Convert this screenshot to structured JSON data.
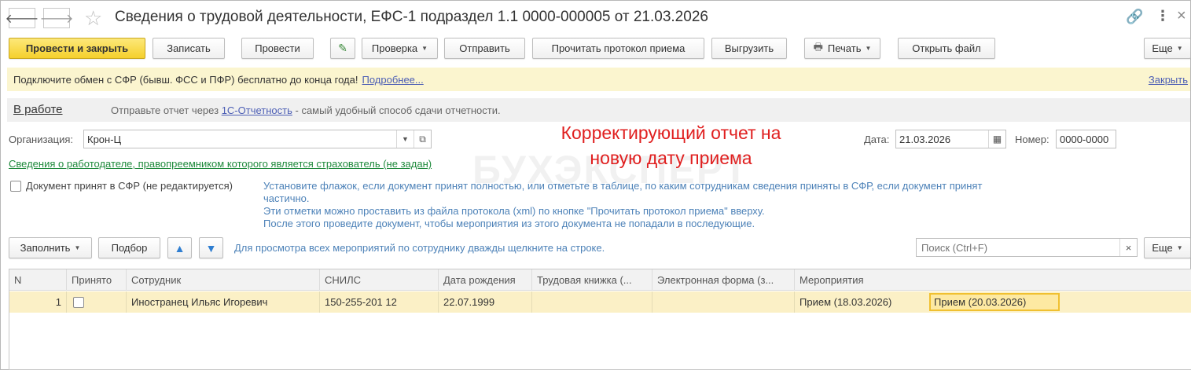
{
  "window": {
    "title": "Сведения о трудовой деятельности, ЕФС-1 подраздел 1.1 0000-000005 от 21.03.2026"
  },
  "toolbar": {
    "post_close": "Провести и закрыть",
    "save": "Записать",
    "post": "Провести",
    "check": "Проверка",
    "send": "Отправить",
    "read_protocol": "Прочитать протокол приема",
    "export": "Выгрузить",
    "print": "Печать",
    "open_file": "Открыть файл",
    "more": "Еще"
  },
  "infobar": {
    "text": "Подключите обмен с СФР (бывш. ФСС и ПФР) бесплатно до конца года!",
    "link": "Подробнее...",
    "close": "Закрыть"
  },
  "status": {
    "label": "В работе",
    "text_before": "Отправьте отчет через",
    "link": "1С-Отчетность",
    "text_after": "- самый удобный способ сдачи отчетности."
  },
  "form": {
    "org_label": "Организация:",
    "org_value": "Крон-Ц",
    "date_label": "Дата:",
    "date_value": "21.03.2026",
    "number_label": "Номер:",
    "number_value": "0000-0000",
    "employer_link": "Сведения о работодателе, правопреемником которого является страхователь (не задан)",
    "accepted_label": "Документ принят в СФР (не редактируется)",
    "hint_line1": "Установите флажок, если документ принят полностью, или отметьте в таблице, по каким сотрудникам сведения приняты в СФР, если документ принят",
    "hint_line2": "частично.",
    "hint_line3": "Эти отметки можно проставить из файла протокола (xml) по кнопке \"Прочитать протокол приема\" вверху.",
    "hint_line4": "После этого проведите документ, чтобы мероприятия из этого документа не попадали в последующие."
  },
  "annotation": {
    "line1": "Корректирующий отчет на",
    "line2": "новую дату приема"
  },
  "watermark": "БУХЭКСПЕРТ",
  "table_toolbar": {
    "fill": "Заполнить",
    "select": "Подбор",
    "hint": "Для просмотра всех мероприятий по сотруднику дважды щелкните на строке.",
    "search_placeholder": "Поиск (Ctrl+F)",
    "more": "Еще"
  },
  "table": {
    "columns": [
      "N",
      "Принято",
      "Сотрудник",
      "СНИЛС",
      "Дата рождения",
      "Трудовая книжка (...",
      "Электронная форма (з...",
      "Мероприятия"
    ],
    "rows": [
      {
        "n": "1",
        "employee": "Иностранец Ильяс Игоревич",
        "snils": "150-255-201 12",
        "birth": "22.07.1999",
        "book": "",
        "eform": "",
        "event1": "Прием (18.03.2026)",
        "event2": "Прием (20.03.2026)"
      }
    ]
  },
  "colors": {
    "primary_button": "#f5d02c",
    "info_bar": "#fbf5cf",
    "selected_row": "#fbf0c6",
    "link": "#4c5eb5",
    "hint": "#4d82b8",
    "green_link": "#1f8a3c",
    "annotation": "#e01f1f"
  }
}
